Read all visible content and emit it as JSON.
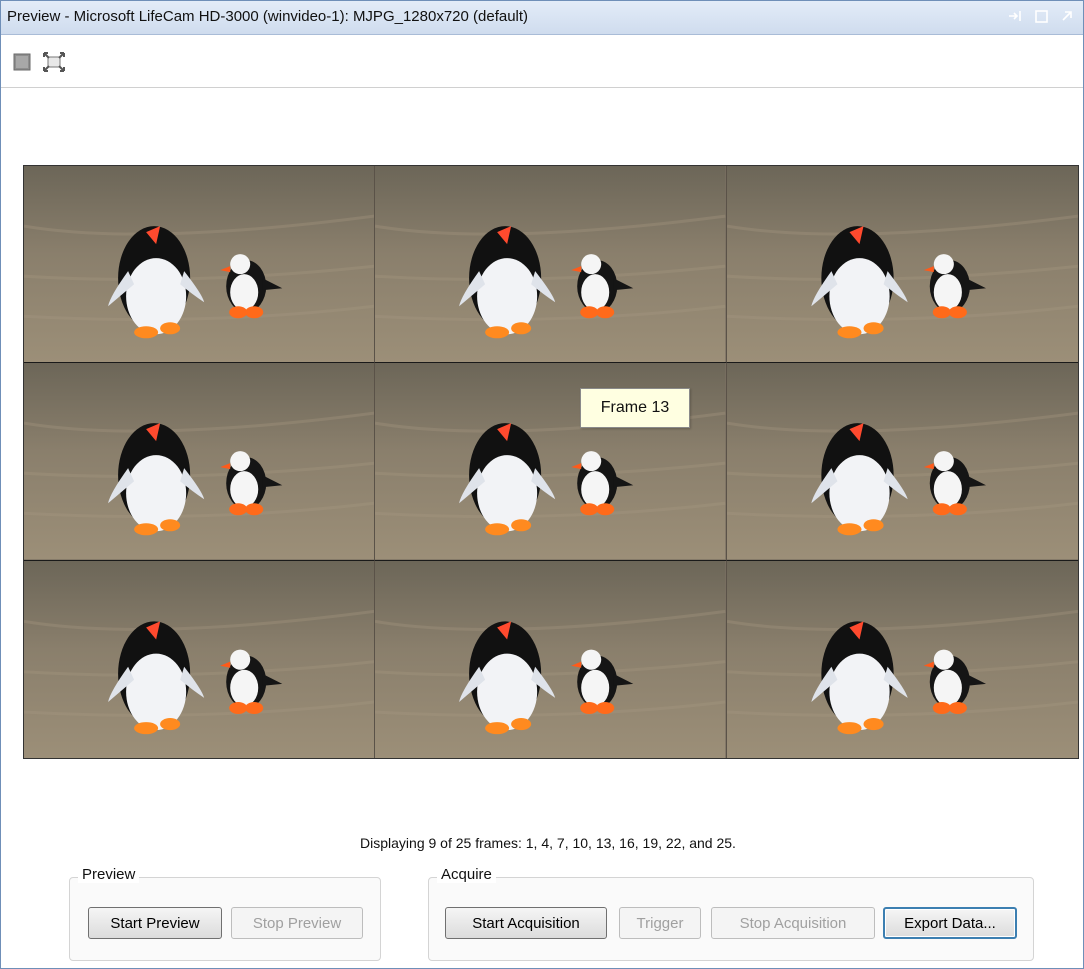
{
  "window": {
    "title": "Preview - Microsoft LifeCam HD-3000 (winvideo-1): MJPG_1280x720 (default)"
  },
  "toolbar": {
    "icons": [
      "stop-square-icon",
      "fit-fullscreen-icon"
    ]
  },
  "preview": {
    "tooltip": "Frame 13"
  },
  "status": {
    "text": "Displaying 9 of 25 frames: 1, 4, 7, 10, 13, 16, 19, 22, and 25."
  },
  "preview_group": {
    "label": "Preview",
    "start_label": "Start Preview",
    "stop_label": "Stop Preview"
  },
  "acquire_group": {
    "label": "Acquire",
    "start_label": "Start Acquisition",
    "trigger_label": "Trigger",
    "stop_label": "Stop Acquisition",
    "export_label": "Export Data..."
  }
}
